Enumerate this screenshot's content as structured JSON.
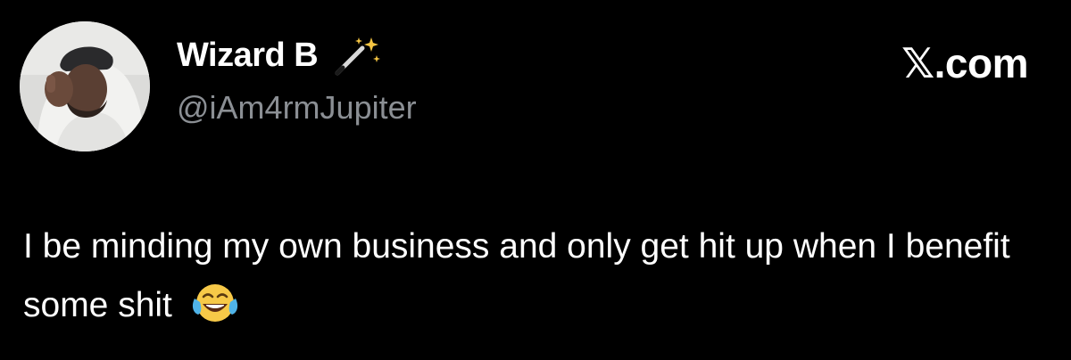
{
  "author": {
    "display_name": "Wizard B",
    "name_emoji": "magic-wand-icon",
    "handle": "@iAm4rmJupiter",
    "avatar": "profile-photo"
  },
  "watermark": {
    "label": "𝕏.com"
  },
  "tweet": {
    "text": "I be minding my own business and only get hit up when I benefit some shit",
    "trailing_emoji": "face-with-tears-of-joy-icon"
  },
  "colors": {
    "background": "#000000",
    "primary_text": "#ffffff",
    "secondary_text": "#8b8f94"
  }
}
